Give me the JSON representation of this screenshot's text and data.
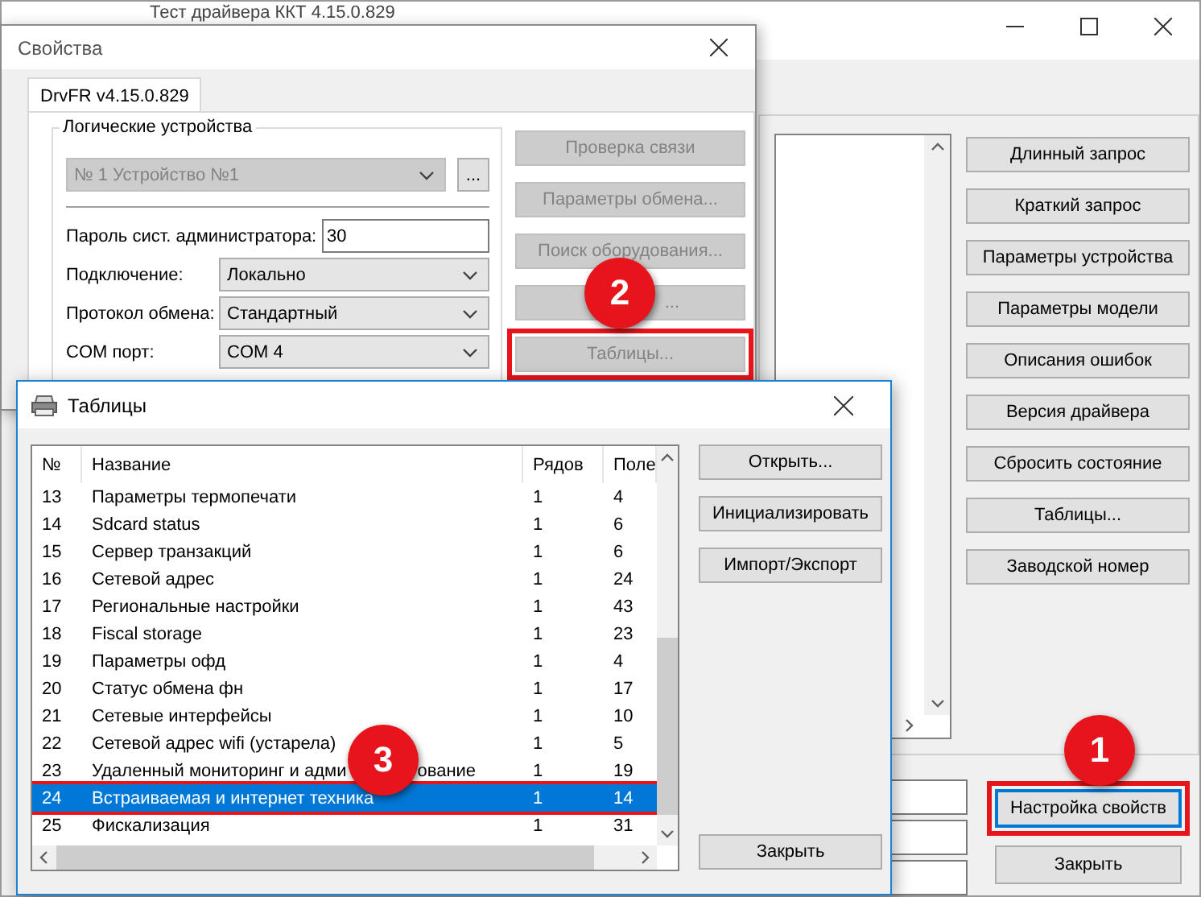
{
  "main_window": {
    "title": "Тест драйвера ККТ 4.15.0.829",
    "buttons": [
      "Длинный запрос",
      "Краткий запрос",
      "Параметры устройства",
      "Параметры модели",
      "Описания ошибок",
      "Версия драйвера",
      "Сбросить состояние",
      "Таблицы...",
      "Заводской номер"
    ],
    "bottom_buttons": [
      {
        "label": "Настройка свойств",
        "highlighted": true
      },
      {
        "label": "Закрыть",
        "highlighted": false
      }
    ]
  },
  "properties_dialog": {
    "title": "Свойства",
    "tab": {
      "label": "DrvFR v4.15.0.829",
      "selected": true
    },
    "group_label": "Логические устройства",
    "device": {
      "value": "№ 1 Устройство №1",
      "disabled": true
    },
    "browse_button": "...",
    "password": {
      "label": "Пароль сист. администратора:",
      "value": "30"
    },
    "fields": [
      {
        "label": "Подключение:",
        "value": "Локально"
      },
      {
        "label": "Протокол обмена:",
        "value": "Стандартный"
      },
      {
        "label": "COM порт:",
        "value": "COM 4"
      }
    ],
    "buttons": [
      {
        "label": "Проверка связи",
        "disabled": true,
        "highlighted": false
      },
      {
        "label": "Параметры обмена...",
        "disabled": true,
        "highlighted": false
      },
      {
        "label": "Поиск оборудования...",
        "disabled": true,
        "highlighted": false
      },
      {
        "label": "...",
        "disabled": true,
        "highlighted": false
      },
      {
        "label": "Таблицы...",
        "disabled": true,
        "highlighted": true
      }
    ]
  },
  "tables_dialog": {
    "title": "Таблицы",
    "columns": [
      "№",
      "Название",
      "Рядов",
      "Поле"
    ],
    "rows": [
      {
        "number": "13",
        "name": "Параметры термопечати",
        "rows": "1",
        "fields": "4",
        "selected": false,
        "highlighted": false
      },
      {
        "number": "14",
        "name": "Sdcard status",
        "rows": "1",
        "fields": "6",
        "selected": false,
        "highlighted": false
      },
      {
        "number": "15",
        "name": "Сервер транзакций",
        "rows": "1",
        "fields": "6",
        "selected": false,
        "highlighted": false
      },
      {
        "number": "16",
        "name": "Сетевой адрес",
        "rows": "1",
        "fields": "24",
        "selected": false,
        "highlighted": false
      },
      {
        "number": "17",
        "name": "Региональные настройки",
        "rows": "1",
        "fields": "43",
        "selected": false,
        "highlighted": false
      },
      {
        "number": "18",
        "name": "Fiscal storage",
        "rows": "1",
        "fields": "23",
        "selected": false,
        "highlighted": false
      },
      {
        "number": "19",
        "name": "Параметры офд",
        "rows": "1",
        "fields": "4",
        "selected": false,
        "highlighted": false
      },
      {
        "number": "20",
        "name": "Статус обмена фн",
        "rows": "1",
        "fields": "17",
        "selected": false,
        "highlighted": false
      },
      {
        "number": "21",
        "name": "Сетевые интерфейсы",
        "rows": "1",
        "fields": "10",
        "selected": false,
        "highlighted": false
      },
      {
        "number": "22",
        "name": "Сетевой адрес wifi (устарела)",
        "rows": "1",
        "fields": "5",
        "selected": false,
        "highlighted": false
      },
      {
        "number": "23",
        "name": "Удаленный мониторинг и адми",
        "name_tail": "ование",
        "rows": "1",
        "fields": "19",
        "selected": false,
        "highlighted": false
      },
      {
        "number": "24",
        "name": "Встраиваемая и интернет техника",
        "rows": "1",
        "fields": "14",
        "selected": true,
        "highlighted": true
      },
      {
        "number": "25",
        "name": "Фискализация",
        "rows": "1",
        "fields": "31",
        "selected": false,
        "highlighted": false
      }
    ],
    "buttons": [
      "Открыть...",
      "Инициализировать",
      "Импорт/Экспорт"
    ],
    "close_button": "Закрыть"
  },
  "callouts": [
    {
      "number": "1"
    },
    {
      "number": "2"
    },
    {
      "number": "3"
    }
  ]
}
